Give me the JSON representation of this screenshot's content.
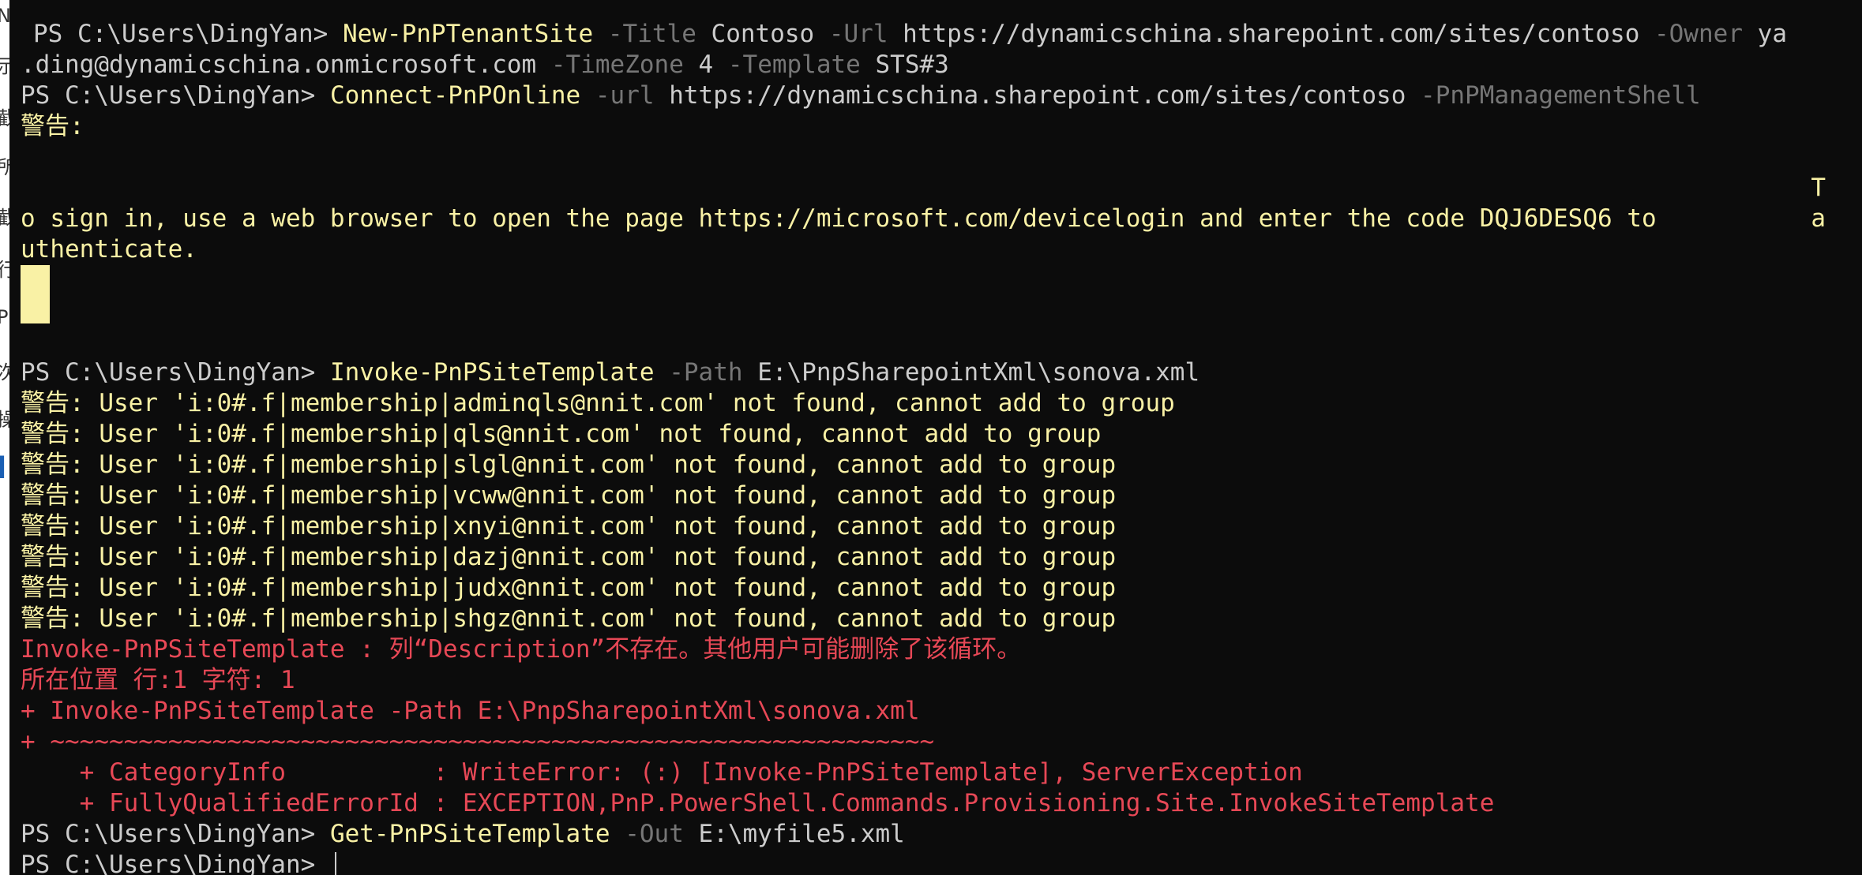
{
  "left_strip": {
    "fragments": [
      "N",
      "示",
      "截",
      "所",
      "截",
      "行",
      "Pr",
      "次",
      "操"
    ]
  },
  "terminal": {
    "prompt": "PS C:\\Users\\DingYan> ",
    "cmd1": {
      "cmdlet": "New-PnPTenantSite",
      "p1": " -Title",
      "v1": " Contoso",
      "p2": " -Url",
      "v2": " https://dynamicschina.sharepoint.com/sites/contoso",
      "p3": " -Owner",
      "v3a": " ya",
      "v3b": ".ding@dynamicschina.onmicrosoft.com",
      "p4": " -TimeZone",
      "v4": " 4",
      "p5": " -Template",
      "v5": " STS#3"
    },
    "cmd2": {
      "cmdlet": "Connect-PnPOnline",
      "p1": " -url",
      "v1": " https://dynamicschina.sharepoint.com/sites/contoso",
      "p2": " -PnPManagementShell"
    },
    "warning_header": "警告:",
    "device_login": {
      "wrap_t": "T",
      "line1": "o sign in, use a web browser to open the page https://microsoft.com/devicelogin and enter the code DQJ6DESQ6 to",
      "wrap_a": "a",
      "line2": "uthenticate."
    },
    "cmd3": {
      "cmdlet": "Invoke-PnPSiteTemplate",
      "p1": " -Path",
      "v1": " E:\\PnpSharepointXml\\sonova.xml"
    },
    "user_warnings": [
      "警告: User 'i:0#.f|membership|adminqls@nnit.com' not found, cannot add to group",
      "警告: User 'i:0#.f|membership|qls@nnit.com' not found, cannot add to group",
      "警告: User 'i:0#.f|membership|slgl@nnit.com' not found, cannot add to group",
      "警告: User 'i:0#.f|membership|vcww@nnit.com' not found, cannot add to group",
      "警告: User 'i:0#.f|membership|xnyi@nnit.com' not found, cannot add to group",
      "警告: User 'i:0#.f|membership|dazj@nnit.com' not found, cannot add to group",
      "警告: User 'i:0#.f|membership|judx@nnit.com' not found, cannot add to group",
      "警告: User 'i:0#.f|membership|shgz@nnit.com' not found, cannot add to group"
    ],
    "error_lines": [
      "Invoke-PnPSiteTemplate : 列“Description”不存在。其他用户可能删除了该循环。",
      "所在位置 行:1 字符: 1",
      "+ Invoke-PnPSiteTemplate -Path E:\\PnpSharepointXml\\sonova.xml",
      "+ ~~~~~~~~~~~~~~~~~~~~~~~~~~~~~~~~~~~~~~~~~~~~~~~~~~~~~~~~~~~~",
      "    + CategoryInfo          : WriteError: (:) [Invoke-PnPSiteTemplate], ServerException",
      "    + FullyQualifiedErrorId : EXCEPTION,PnP.PowerShell.Commands.Provisioning.Site.InvokeSiteTemplate"
    ],
    "cmd4": {
      "cmdlet": "Get-PnPSiteTemplate",
      "p1": " -Out",
      "v1": " E:\\myfile5.xml"
    }
  },
  "colors": {
    "background": "#0c0c0c",
    "foreground": "#cccccc",
    "cmdlet_warning": "#f9f1a5",
    "parameter": "#767676",
    "error": "#e74856"
  }
}
